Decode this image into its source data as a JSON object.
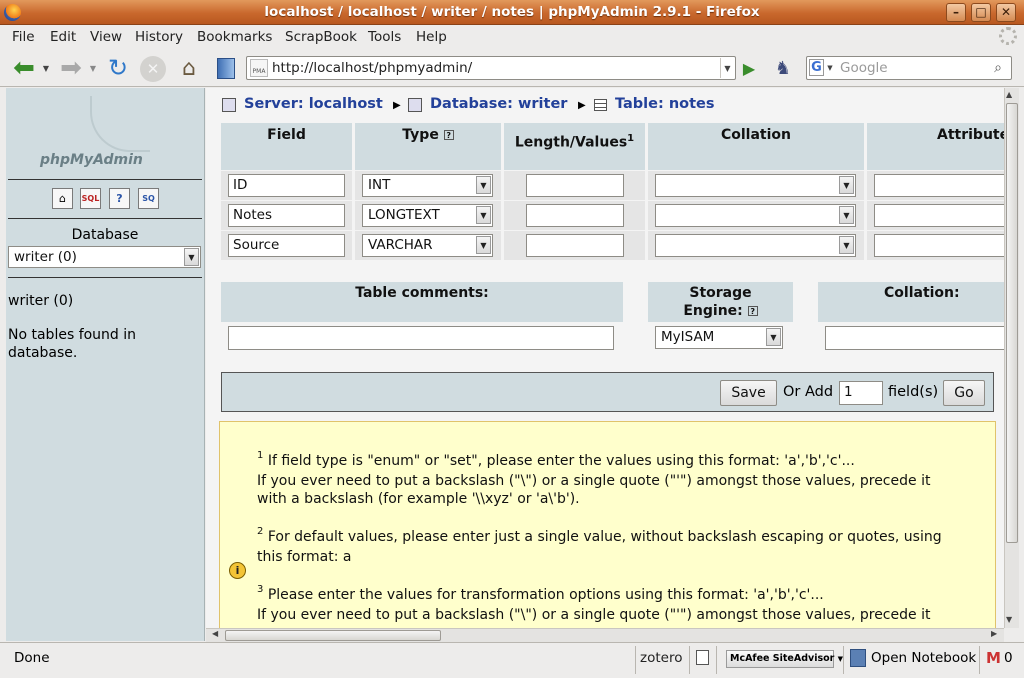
{
  "window": {
    "title": "localhost / localhost / writer / notes | phpMyAdmin 2.9.1 - Firefox"
  },
  "menu": [
    "File",
    "Edit",
    "View",
    "History",
    "Bookmarks",
    "ScrapBook",
    "Tools",
    "Help"
  ],
  "toolbar": {
    "url": "http://localhost/phpmyadmin/",
    "search_placeholder": "Google",
    "search_engine_letter": "G",
    "pma_favicon_text": "PMA"
  },
  "sidebar": {
    "logo": "phpMyAdmin",
    "database_label": "Database",
    "database_selected": "writer (0)",
    "db_name": "writer (0)",
    "empty_msg": "No tables found in database."
  },
  "breadcrumb": {
    "server": "Server: localhost",
    "database": "Database: writer",
    "table": "Table: notes"
  },
  "fields_table": {
    "headers": [
      "Field",
      "Type",
      "Length/Values",
      "Collation",
      "Attribute"
    ],
    "length_sup": "1",
    "rows": [
      {
        "name": "ID",
        "type": "INT"
      },
      {
        "name": "Notes",
        "type": "LONGTEXT"
      },
      {
        "name": "Source",
        "type": "VARCHAR"
      }
    ]
  },
  "table_options": {
    "comments_label": "Table comments:",
    "engine_label_1": "Storage",
    "engine_label_2": "Engine:",
    "engine_value": "MyISAM",
    "collation_label": "Collation:"
  },
  "actions": {
    "save": "Save",
    "or_add": "Or Add",
    "add_count": "1",
    "fields_suffix": "field(s)",
    "go": "Go"
  },
  "notes": {
    "n1_num": "1",
    "n1_l1": "If field type is \"enum\" or \"set\", please enter the values using this format: 'a','b','c'...",
    "n1_l2": "If you ever need to put a backslash (\"\\\") or a single quote (\"'\") amongst those values, precede it",
    "n1_l3": "with a backslash (for example '\\\\xyz' or 'a\\'b').",
    "n2_num": "2",
    "n2_l1": "For default values, please enter just a single value, without backslash escaping or quotes, using",
    "n2_l2": "this format: a",
    "n3_num": "3",
    "n3_l1": "Please enter the values for transformation options using this format: 'a','b','c'...",
    "n3_l2": "If you ever need to put a backslash (\"\\\") or a single quote (\"'\") amongst those values, precede it"
  },
  "status": {
    "text": "Done",
    "zotero": "zotero",
    "mcafee": "McAfee SiteAdvisor",
    "notebook": "Open Notebook",
    "mail_count": "0"
  }
}
